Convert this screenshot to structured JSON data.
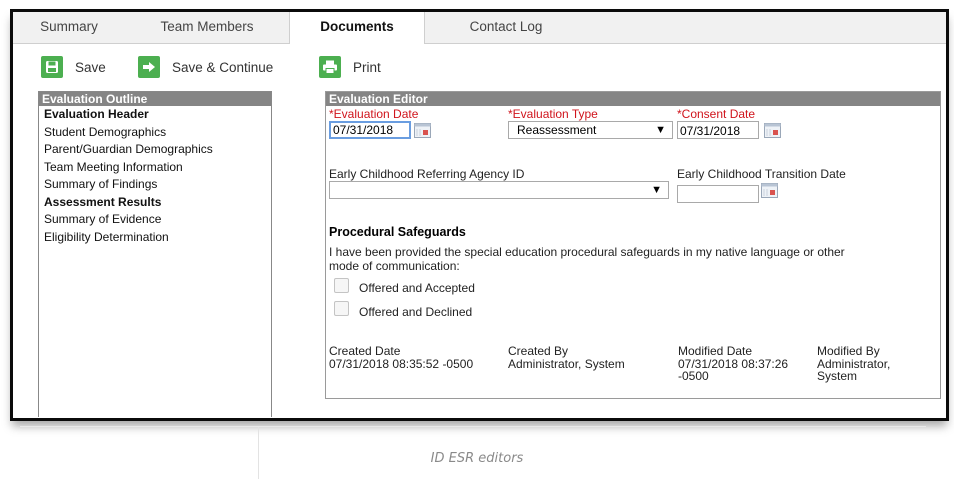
{
  "tabs": [
    {
      "label": "Summary"
    },
    {
      "label": "Team Members"
    },
    {
      "label": "Documents"
    },
    {
      "label": "Contact Log"
    }
  ],
  "toolbar": {
    "save_label": "Save",
    "save_continue_label": "Save & Continue",
    "print_label": "Print",
    "icon_color": "#4caf50"
  },
  "outline": {
    "title": "Evaluation Outline",
    "items": [
      {
        "label": "Evaluation Header"
      },
      {
        "label": "Student Demographics"
      },
      {
        "label": "Parent/Guardian Demographics"
      },
      {
        "label": "Team Meeting Information"
      },
      {
        "label": "Summary of Findings"
      },
      {
        "label": "Assessment Results"
      },
      {
        "label": "Summary of Evidence"
      },
      {
        "label": "Eligibility Determination"
      }
    ]
  },
  "editor": {
    "title": "Evaluation Editor",
    "evaluation_date": {
      "label": "*Evaluation Date",
      "value": "07/31/2018"
    },
    "evaluation_type": {
      "label": "*Evaluation Type",
      "value": "Reassessment"
    },
    "consent_date": {
      "label": "*Consent Date",
      "value": "07/31/2018"
    },
    "referring_agency": {
      "label": "Early Childhood Referring Agency ID",
      "value": ""
    },
    "transition_date": {
      "label": "Early Childhood Transition Date",
      "value": ""
    },
    "safeguards": {
      "heading": "Procedural Safeguards",
      "text_line1": "I have been provided the special education procedural safeguards in my native language or other",
      "text_line2": "mode of communication:",
      "option_accepted": "Offered and Accepted",
      "option_declined": "Offered and Declined"
    },
    "meta": {
      "created_date_label": "Created Date",
      "created_date_value": "07/31/2018 08:35:52 -0500",
      "created_by_label": "Created By",
      "created_by_value": "Administrator, System",
      "modified_date_label": "Modified Date",
      "modified_date_value_1": "07/31/2018 08:37:26",
      "modified_date_value_2": "-0500",
      "modified_by_label": "Modified By",
      "modified_by_value_1": "Administrator,",
      "modified_by_value_2": "System"
    }
  },
  "caption": "ID ESR editors",
  "colors": {
    "required": "#d0141c",
    "panel_header": "#858585",
    "focus_border": "#6a9de0"
  }
}
